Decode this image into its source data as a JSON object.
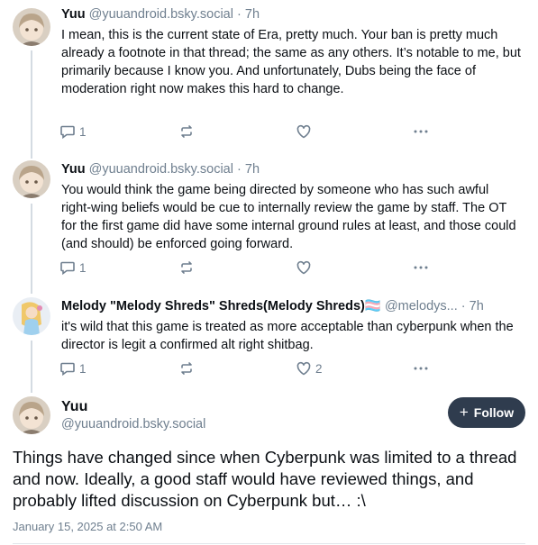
{
  "posts": [
    {
      "author": "Yuu",
      "handle": "@yuuandroid.bsky.social",
      "sep": "·",
      "time": "7h",
      "text": "I mean, this is the current state of Era, pretty much. Your ban is pretty much already a footnote in that thread; the same as any others. It’s notable to me, but primarily because I know you. And unfortunately, Dubs being the face of moderation right now makes this hard to change.",
      "replies": "1",
      "reposts": "",
      "likes": ""
    },
    {
      "author": "Yuu",
      "handle": "@yuuandroid.bsky.social",
      "sep": "·",
      "time": "7h",
      "text": "You would think the game being directed by someone who has such awful right-wing beliefs would be cue to internally review the game by staff. The OT for the first game did have some internal ground rules at least, and those could (and should) be enforced going forward.",
      "replies": "1",
      "reposts": "",
      "likes": ""
    },
    {
      "author": "Melody \"Melody Shreds\" Shreds(Melody Shreds)🏳️‍⚧️",
      "handle": "@melodys...",
      "sep": "·",
      "time": "7h",
      "text": "it's wild that this game is treated as more acceptable than cyberpunk when the director is legit a confirmed alt right shitbag.",
      "replies": "1",
      "reposts": "",
      "likes": "2"
    }
  ],
  "main_post": {
    "author": "Yuu",
    "handle": "@yuuandroid.bsky.social",
    "follow_label": "Follow",
    "follow_icon": "+",
    "text": "Things have changed since when Cyberpunk was limited to a thread and now. Ideally, a good staff would have reviewed things, and probably lifted discussion on Cyberpunk but… :\\",
    "date": "January 15, 2025 at 2:50 AM"
  },
  "colors": {
    "text": "#0b0f14",
    "muted": "#6f7f8f",
    "thread_line": "#d4dbe2",
    "follow_bg": "#2f3c4e"
  },
  "icons": {
    "reply": "reply-bubble-icon",
    "repost": "repost-arrows-icon",
    "like": "heart-icon",
    "more": "more-dots-icon"
  }
}
